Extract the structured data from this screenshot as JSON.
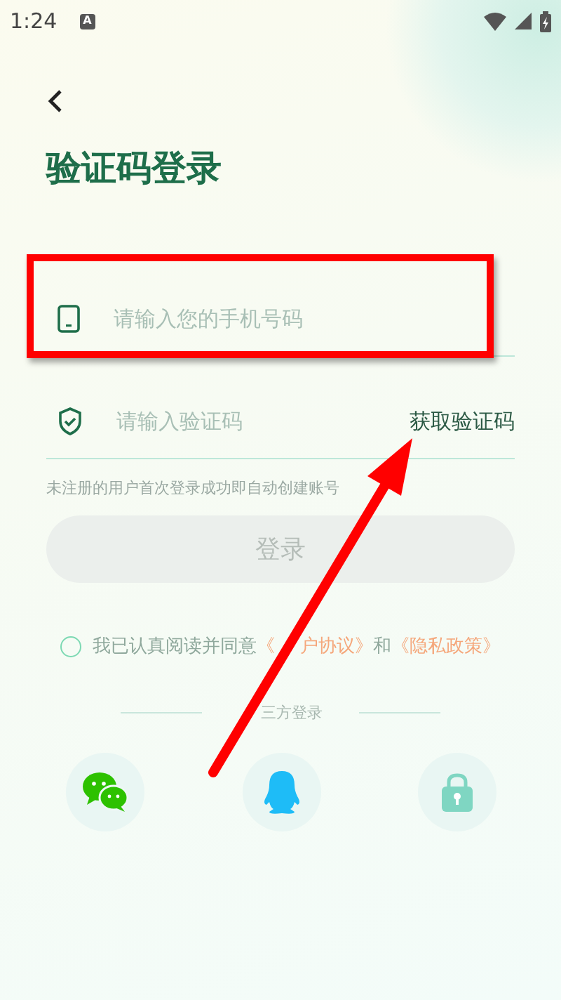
{
  "status_bar": {
    "time": "1:24",
    "notification": "A"
  },
  "title": "验证码登录",
  "phone_field": {
    "placeholder": "请输入您的手机号码"
  },
  "code_field": {
    "placeholder": "请输入验证码",
    "action": "获取验证码"
  },
  "hint": "未注册的用户首次登录成功即自动创建账号",
  "login_button": {
    "label": "登录",
    "disabled": true
  },
  "agreement": {
    "checked": false,
    "text": "我已认真阅读并同意",
    "link_1_start": "《",
    "link_1_end": "户协议》",
    "joiner": "和",
    "link_2": "《隐私政策》"
  },
  "third_party": {
    "label": "三方登录",
    "options": [
      {
        "kind": "wechat"
      },
      {
        "kind": "qq"
      },
      {
        "kind": "lock"
      }
    ]
  },
  "annotations": {
    "highlight_frame": true,
    "arrow": true
  }
}
